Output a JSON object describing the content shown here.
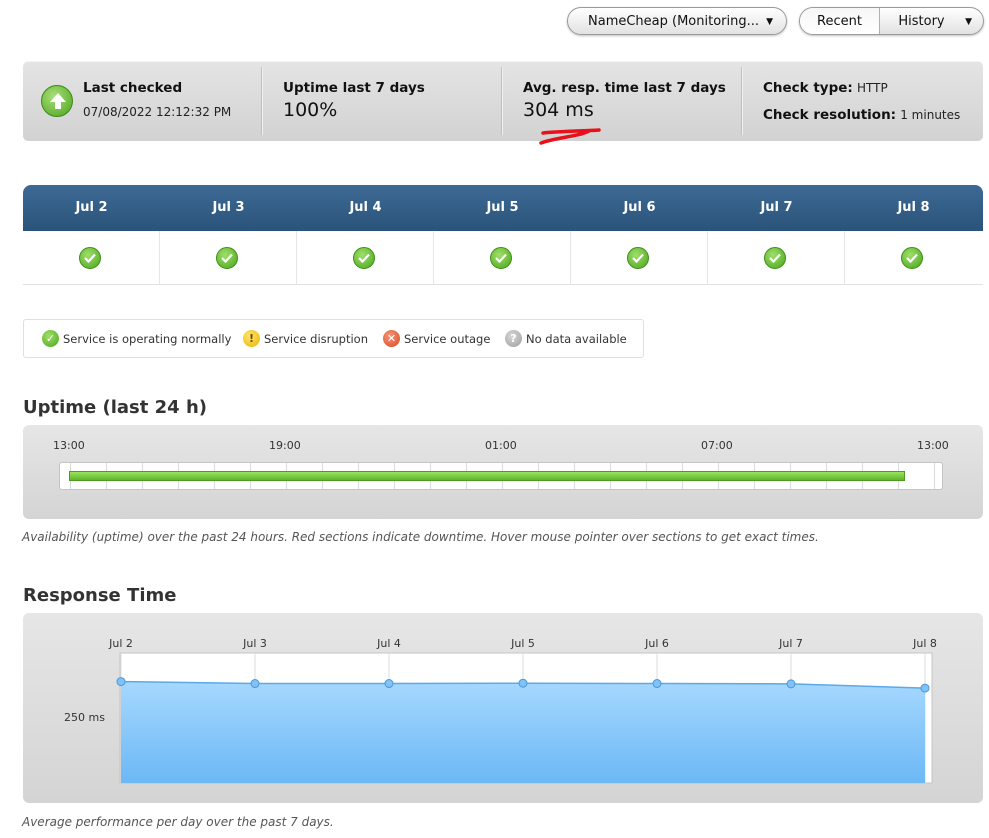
{
  "controls": {
    "monitor_select": "NameCheap (Monitoring...",
    "recent_label": "Recent",
    "history_label": "History"
  },
  "summary": {
    "last_checked_label": "Last checked",
    "last_checked_value": "07/08/2022 12:12:32 PM",
    "uptime_label": "Uptime last 7 days",
    "uptime_value": "100%",
    "resp_label": "Avg. resp. time last 7 days",
    "resp_value": "304 ms",
    "check_type_label": "Check type:",
    "check_type_value": "HTTP",
    "check_res_label": "Check resolution:",
    "check_res_value": "1 minutes"
  },
  "days": [
    "Jul 2",
    "Jul 3",
    "Jul 4",
    "Jul 5",
    "Jul 6",
    "Jul 7",
    "Jul 8"
  ],
  "day_status": [
    "ok",
    "ok",
    "ok",
    "ok",
    "ok",
    "ok",
    "ok"
  ],
  "legend": {
    "ok": "Service is operating normally",
    "disruption": "Service disruption",
    "outage": "Service outage",
    "nodata": "No data available"
  },
  "uptime": {
    "title": "Uptime (last 24 h)",
    "ticks": [
      "13:00",
      "19:00",
      "01:00",
      "07:00",
      "13:00"
    ],
    "uptime_fraction": 1.0,
    "note": "Availability (uptime) over the past 24 hours. Red sections indicate downtime. Hover mouse pointer over sections to get exact times."
  },
  "response": {
    "title": "Response Time",
    "y_label": "250 ms",
    "note": "Average performance per day over the past 7 days."
  },
  "chart_data": {
    "type": "area",
    "categories": [
      "Jul 2",
      "Jul 3",
      "Jul 4",
      "Jul 5",
      "Jul 6",
      "Jul 7",
      "Jul 8"
    ],
    "values": [
      312,
      306,
      306,
      307,
      306,
      305,
      292
    ],
    "y_ticks": [
      250
    ],
    "ylim": [
      0,
      400
    ],
    "grid": true,
    "colors": {
      "fill": "#8ccbff",
      "line": "#5aa9ea"
    }
  },
  "colors": {
    "header_blue": "#2f5a82",
    "ok_green": "#4aa51c",
    "annotation_red": "#e8101a"
  }
}
